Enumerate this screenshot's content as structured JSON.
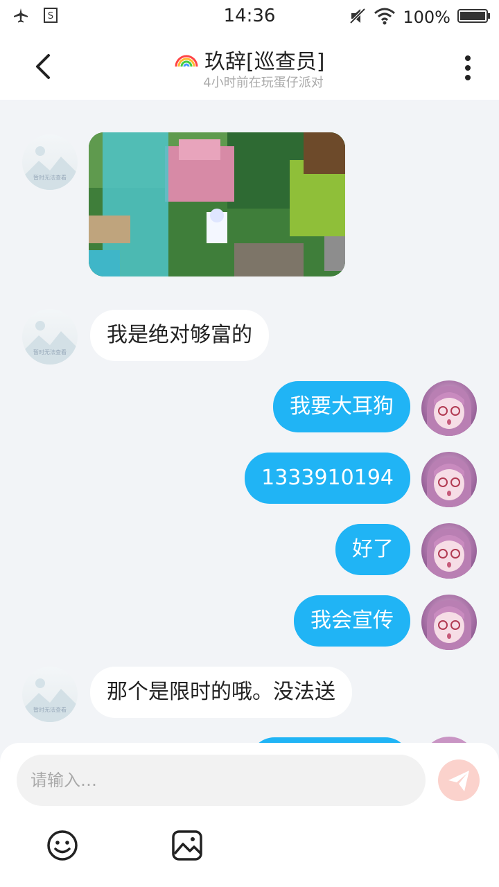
{
  "status_bar": {
    "time": "14:36",
    "battery": "100%"
  },
  "header": {
    "title": "玖辞[巡查员]",
    "subtitle": "4小时前在玩蛋仔派对"
  },
  "messages": [
    {
      "side": "left",
      "type": "image"
    },
    {
      "side": "left",
      "text": "我是绝对够富的"
    },
    {
      "side": "right",
      "text": "我要大耳狗"
    },
    {
      "side": "right",
      "text": "1333910194"
    },
    {
      "side": "right",
      "text": "好了"
    },
    {
      "side": "right",
      "text": "我会宣传"
    },
    {
      "side": "left",
      "text": "那个是限时的哦。没法送"
    }
  ],
  "placeholder_avatar_caption": "暂时无法查看",
  "composer": {
    "placeholder": "请输入…"
  },
  "colors": {
    "bubble_right": "#20b4f5",
    "bubble_left": "#ffffff",
    "background": "#f2f4f7"
  }
}
